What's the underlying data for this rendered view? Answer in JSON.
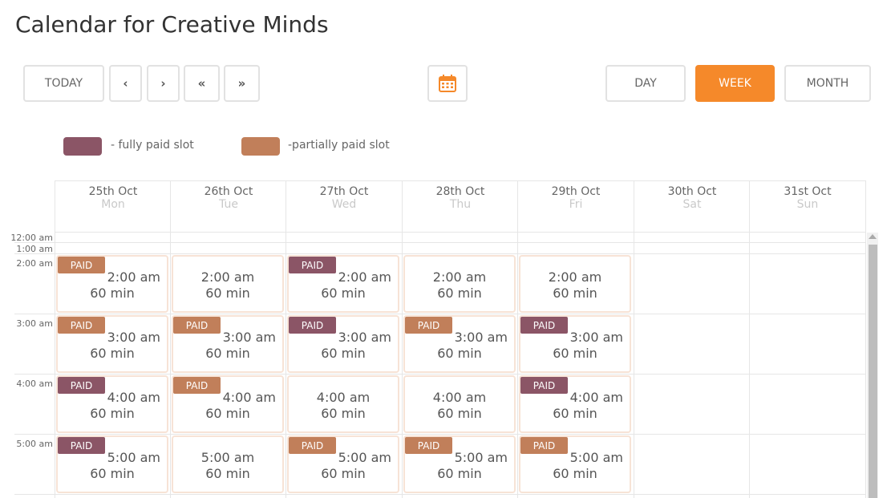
{
  "title": "Calendar for Creative Minds",
  "toolbar": {
    "today": "TODAY",
    "prev": "‹",
    "next": "›",
    "prev_fast": "«",
    "next_fast": "»",
    "views": [
      "DAY",
      "WEEK",
      "MONTH"
    ],
    "active_view": "WEEK"
  },
  "legend": [
    {
      "label": "- fully paid slot",
      "color": "#8b5566"
    },
    {
      "label": "-partially paid slot",
      "color": "#c17f5a"
    }
  ],
  "days": [
    {
      "date": "25th Oct",
      "dow": "Mon"
    },
    {
      "date": "26th Oct",
      "dow": "Tue"
    },
    {
      "date": "27th Oct",
      "dow": "Wed"
    },
    {
      "date": "28th Oct",
      "dow": "Thu"
    },
    {
      "date": "29th Oct",
      "dow": "Fri"
    },
    {
      "date": "30th Oct",
      "dow": "Sat"
    },
    {
      "date": "31st Oct",
      "dow": "Sun"
    }
  ],
  "time_labels": [
    "12:00 am",
    "1:00 am",
    "2:00 am",
    "3:00 am",
    "4:00 am",
    "5:00 am"
  ],
  "paid_label": "PAID",
  "colors": {
    "fully_paid": "#8b5566",
    "partially_paid": "#c17f5a",
    "accent": "#f5892a"
  },
  "slots": [
    {
      "day": 0,
      "hour": 0,
      "time": "2:00 am",
      "duration": "60 min",
      "status": "partial"
    },
    {
      "day": 1,
      "hour": 0,
      "time": "2:00 am",
      "duration": "60 min",
      "status": "none"
    },
    {
      "day": 2,
      "hour": 0,
      "time": "2:00 am",
      "duration": "60 min",
      "status": "full"
    },
    {
      "day": 3,
      "hour": 0,
      "time": "2:00 am",
      "duration": "60 min",
      "status": "none"
    },
    {
      "day": 4,
      "hour": 0,
      "time": "2:00 am",
      "duration": "60 min",
      "status": "none"
    },
    {
      "day": 0,
      "hour": 1,
      "time": "3:00 am",
      "duration": "60 min",
      "status": "partial"
    },
    {
      "day": 1,
      "hour": 1,
      "time": "3:00 am",
      "duration": "60 min",
      "status": "partial"
    },
    {
      "day": 2,
      "hour": 1,
      "time": "3:00 am",
      "duration": "60 min",
      "status": "full"
    },
    {
      "day": 3,
      "hour": 1,
      "time": "3:00 am",
      "duration": "60 min",
      "status": "partial"
    },
    {
      "day": 4,
      "hour": 1,
      "time": "3:00 am",
      "duration": "60 min",
      "status": "full"
    },
    {
      "day": 0,
      "hour": 2,
      "time": "4:00 am",
      "duration": "60 min",
      "status": "full"
    },
    {
      "day": 1,
      "hour": 2,
      "time": "4:00 am",
      "duration": "60 min",
      "status": "partial"
    },
    {
      "day": 2,
      "hour": 2,
      "time": "4:00 am",
      "duration": "60 min",
      "status": "none"
    },
    {
      "day": 3,
      "hour": 2,
      "time": "4:00 am",
      "duration": "60 min",
      "status": "none"
    },
    {
      "day": 4,
      "hour": 2,
      "time": "4:00 am",
      "duration": "60 min",
      "status": "full"
    },
    {
      "day": 0,
      "hour": 3,
      "time": "5:00 am",
      "duration": "60 min",
      "status": "full"
    },
    {
      "day": 1,
      "hour": 3,
      "time": "5:00 am",
      "duration": "60 min",
      "status": "none"
    },
    {
      "day": 2,
      "hour": 3,
      "time": "5:00 am",
      "duration": "60 min",
      "status": "partial"
    },
    {
      "day": 3,
      "hour": 3,
      "time": "5:00 am",
      "duration": "60 min",
      "status": "partial"
    },
    {
      "day": 4,
      "hour": 3,
      "time": "5:00 am",
      "duration": "60 min",
      "status": "partial"
    }
  ]
}
